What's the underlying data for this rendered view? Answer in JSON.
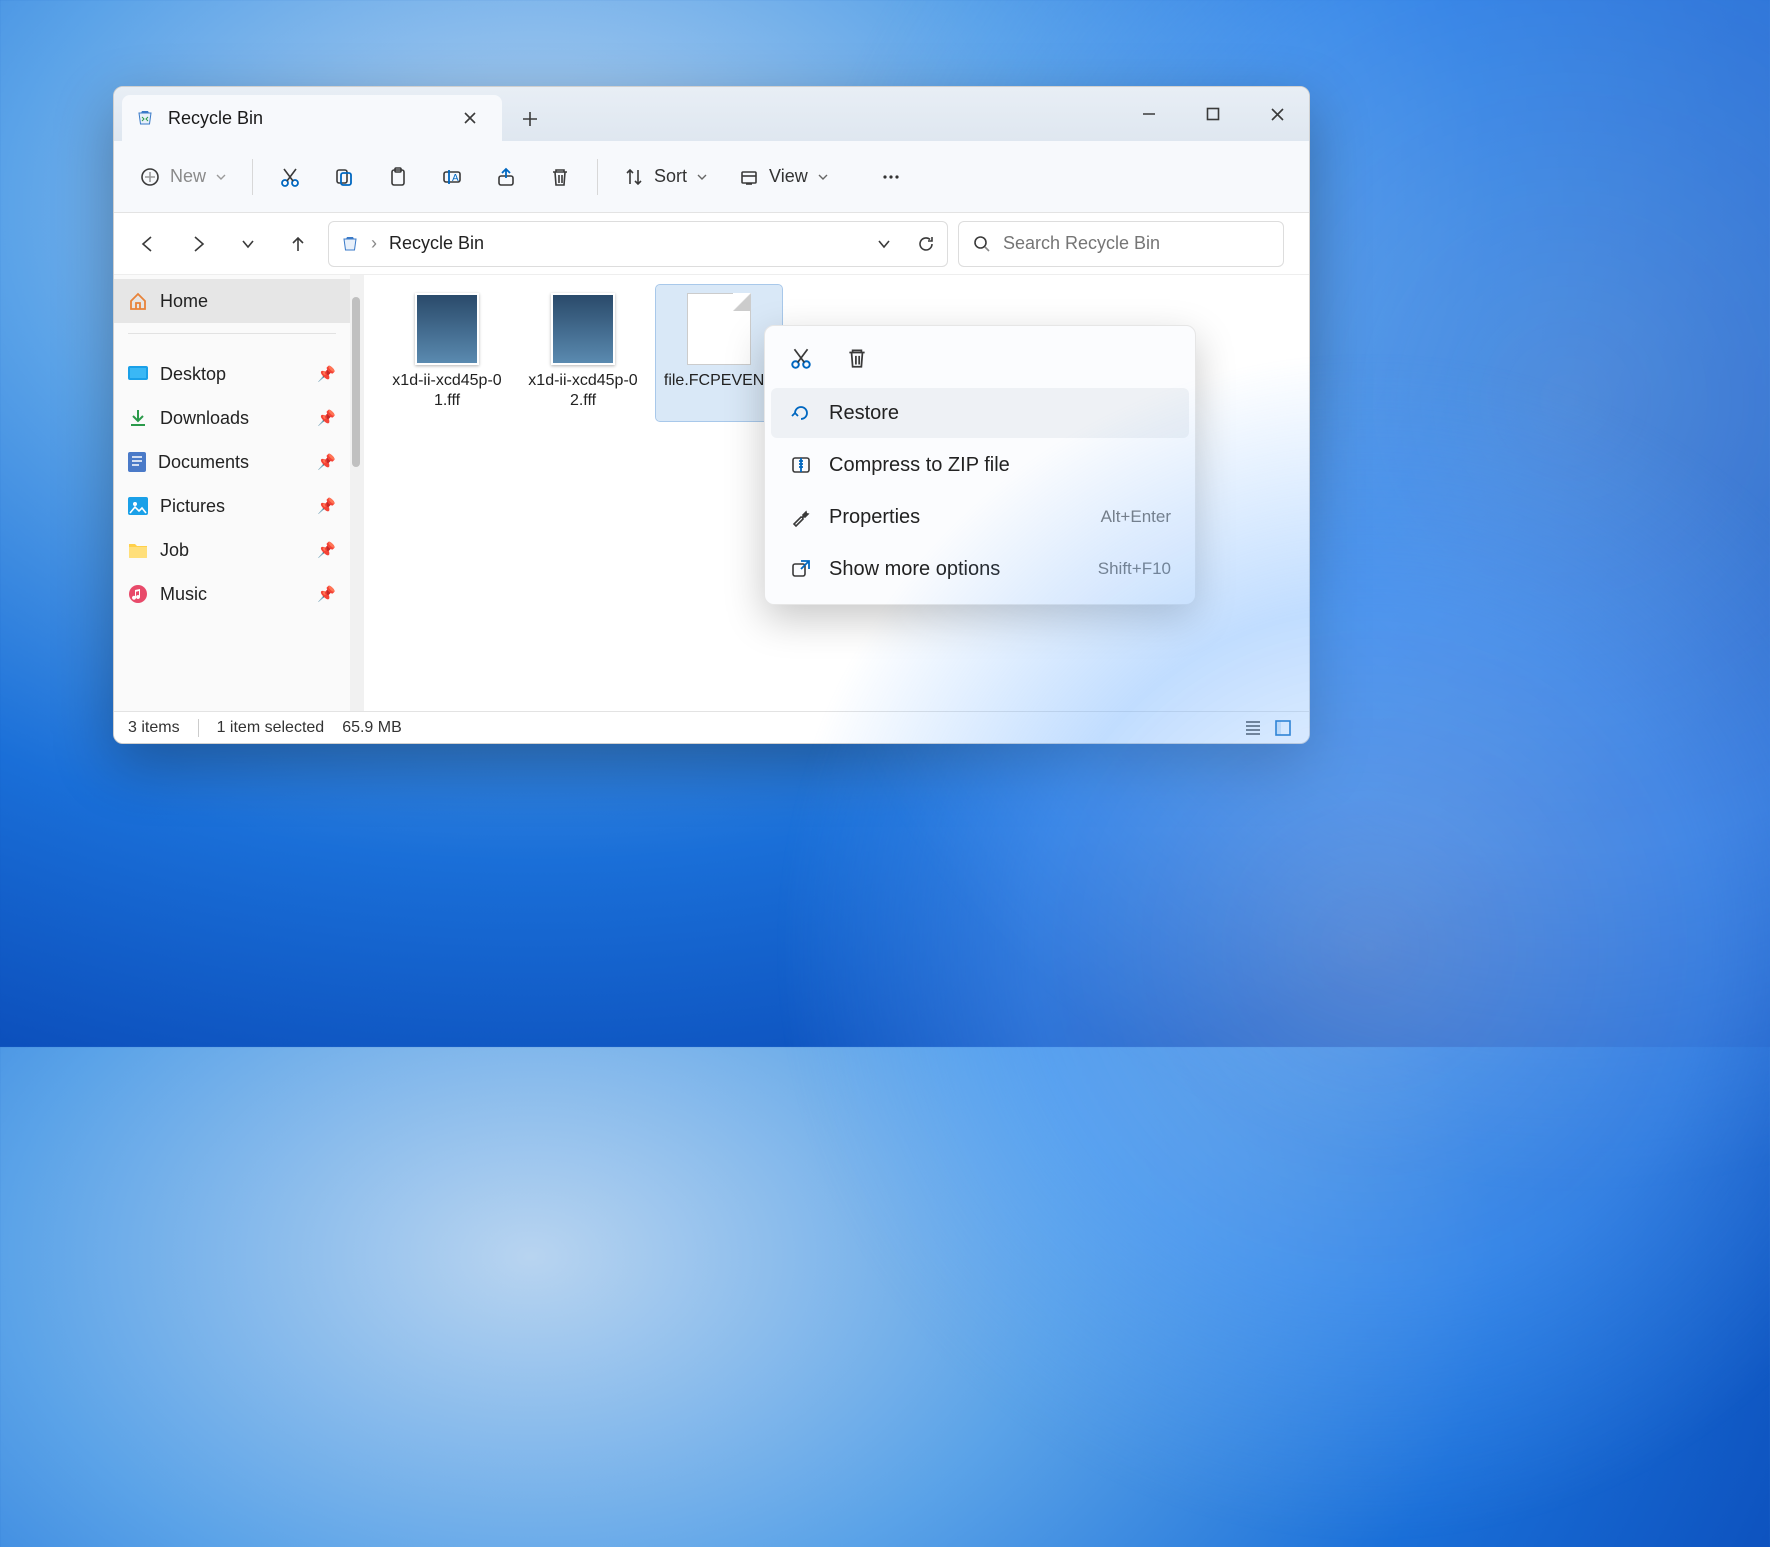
{
  "tab": {
    "title": "Recycle Bin"
  },
  "toolbar": {
    "new_label": "New",
    "sort_label": "Sort",
    "view_label": "View"
  },
  "breadcrumb": {
    "location": "Recycle Bin"
  },
  "search": {
    "placeholder": "Search Recycle Bin"
  },
  "sidebar": {
    "home": "Home",
    "items": [
      {
        "label": "Desktop"
      },
      {
        "label": "Downloads"
      },
      {
        "label": "Documents"
      },
      {
        "label": "Pictures"
      },
      {
        "label": "Job"
      },
      {
        "label": "Music"
      }
    ]
  },
  "files": [
    {
      "name": "x1d-ii-xcd45p-01.fff"
    },
    {
      "name": "x1d-ii-xcd45p-02.fff"
    },
    {
      "name": "file.FCPEVENT"
    }
  ],
  "context_menu": {
    "restore": "Restore",
    "compress": "Compress to ZIP file",
    "properties": "Properties",
    "properties_shortcut": "Alt+Enter",
    "more": "Show more options",
    "more_shortcut": "Shift+F10"
  },
  "status": {
    "items": "3 items",
    "selected": "1 item selected",
    "size": "65.9 MB"
  }
}
